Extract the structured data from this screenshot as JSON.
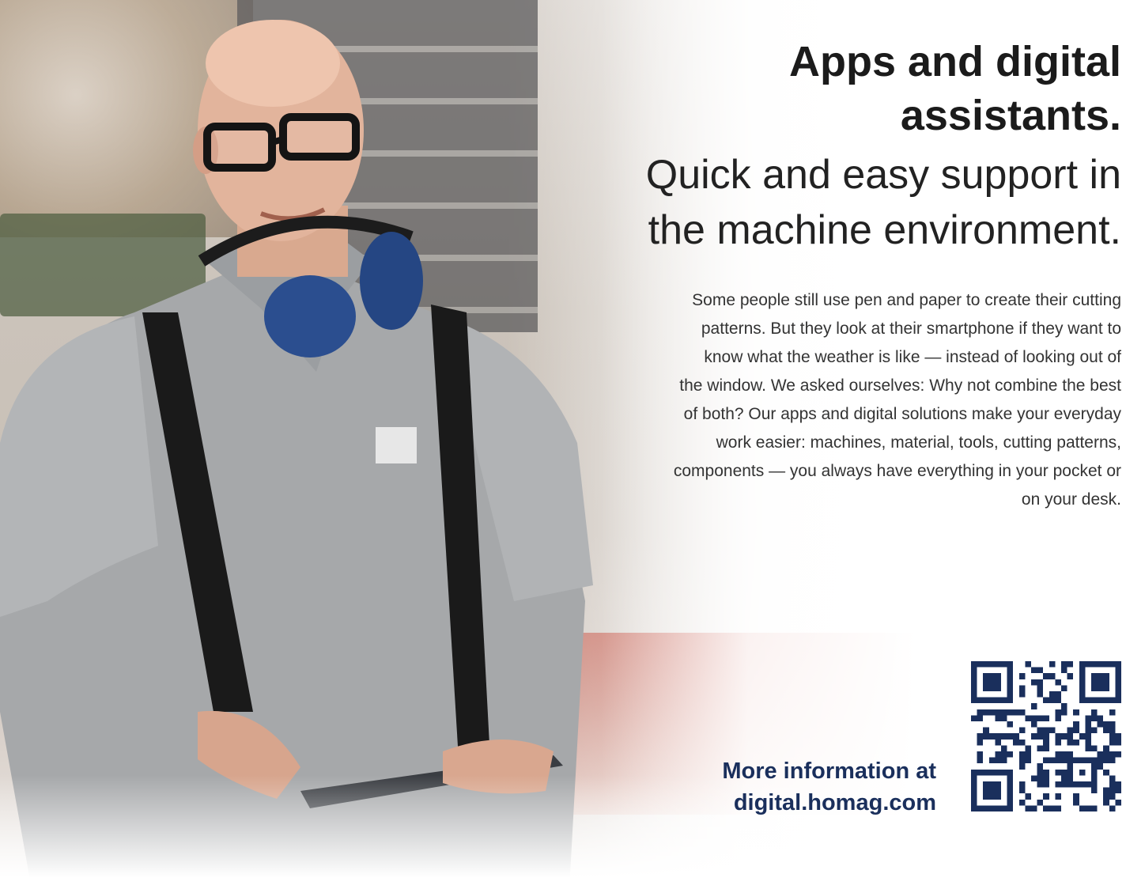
{
  "headline": {
    "line1": "Apps and digital",
    "line2": "assistants."
  },
  "subheadline": {
    "line1": "Quick and easy support in",
    "line2": "the machine environment."
  },
  "body": {
    "lines": [
      "Some people still use pen and paper to create their cutting",
      "patterns. But they look at their smartphone if they want to",
      "know what the weather is like — instead of looking out of",
      "the window. We asked ourselves: Why not combine the best",
      "of both? Our apps and digital solutions make your everyday",
      "work easier: machines, material, tools, cutting patterns,",
      "components — you always have everything in your pocket or",
      "on your desk."
    ]
  },
  "cta": {
    "line1": "More information at",
    "line2": "digital.homag.com"
  },
  "qr_code": {
    "icon": "qr-code-icon",
    "color": "#1a2f5c"
  },
  "colors": {
    "headline": "#1b1b1b",
    "cta": "#1a2f5c"
  }
}
